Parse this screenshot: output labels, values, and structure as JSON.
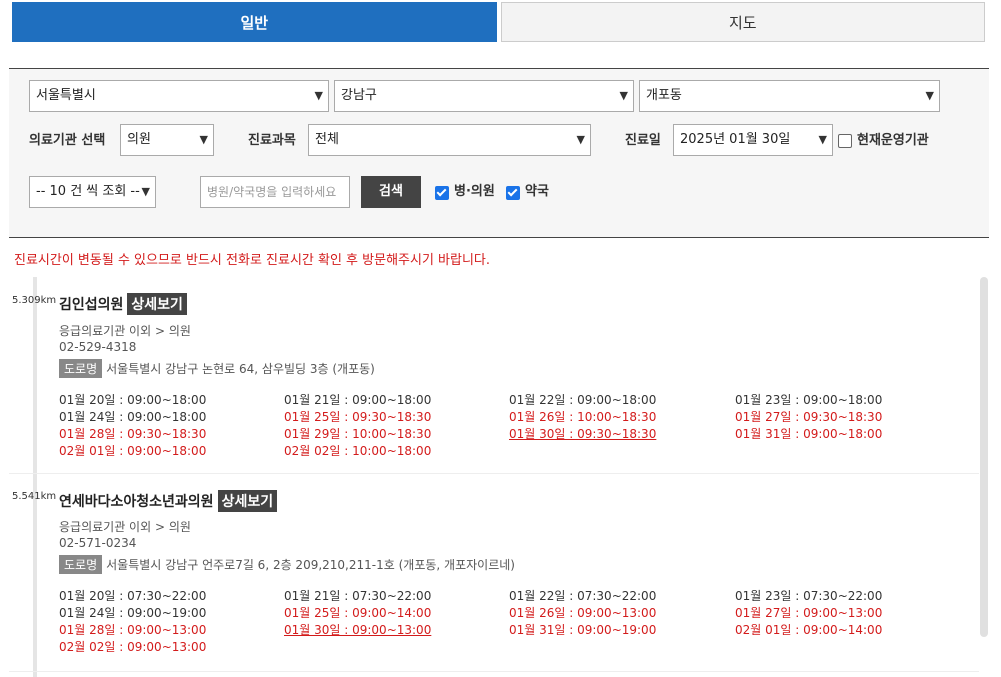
{
  "tabs": {
    "general": "일반",
    "map": "지도"
  },
  "filters": {
    "city": "서울특별시",
    "district": "강남구",
    "dong": "개포동",
    "facility_label": "의료기관 선택",
    "facility": "의원",
    "dept_label": "진료과목",
    "dept": "전체",
    "date_label": "진료일",
    "date": "2025년 01월 30일",
    "operating_label": "현재운영기관",
    "page_size": "-- 10 건 씩 조회 --",
    "search_placeholder": "병원/약국명을 입력하세요",
    "search_button": "검색",
    "clinic_check": "병·의원",
    "pharmacy_check": "약국"
  },
  "notice": "진료시간이 변동될 수 있으므로 반드시 전화로 진료시간 확인 후 방문해주시기 바랍니다.",
  "detail_label": "상세보기",
  "road_badge": "도로명",
  "results": [
    {
      "distance": "5.309km",
      "name": "김인섭의원",
      "category": "응급의료기관 이외 > 의원",
      "phone": "02-529-4318",
      "address": "서울특별시 강남구 논현로 64, 삼우빌딩 3층 (개포동)",
      "schedule": [
        "01월 20일 : 09:00~18:00",
        "01월 21일 : 09:00~18:00",
        "01월 22일 : 09:00~18:00",
        "01월 23일 : 09:00~18:00",
        "01월 24일 : 09:00~18:00",
        "01월 25일 : 09:30~18:30",
        "01월 26일 : 10:00~18:30",
        "01월 27일 : 09:30~18:30",
        "01월 28일 : 09:30~18:30",
        "01월 29일 : 10:00~18:30",
        "01월 30일 : 09:30~18:30",
        "01월 31일 : 09:00~18:00",
        "02월 01일 : 09:00~18:00",
        "02월 02일 : 10:00~18:00"
      ]
    },
    {
      "distance": "5.541km",
      "name": "연세바다소아청소년과의원",
      "category": "응급의료기관 이외 > 의원",
      "phone": "02-571-0234",
      "address": "서울특별시 강남구 언주로7길 6, 2층 209,210,211-1호 (개포동, 개포자이르네)",
      "schedule": [
        "01월 20일 : 07:30~22:00",
        "01월 21일 : 07:30~22:00",
        "01월 22일 : 07:30~22:00",
        "01월 23일 : 07:30~22:00",
        "01월 24일 : 09:00~19:00",
        "01월 25일 : 09:00~14:00",
        "01월 26일 : 09:00~13:00",
        "01월 27일 : 09:00~13:00",
        "01월 28일 : 09:00~13:00",
        "01월 30일 : 09:00~13:00",
        "01월 31일 : 09:00~19:00",
        "02월 01일 : 09:00~14:00",
        "02월 02일 : 09:00~13:00"
      ]
    }
  ]
}
